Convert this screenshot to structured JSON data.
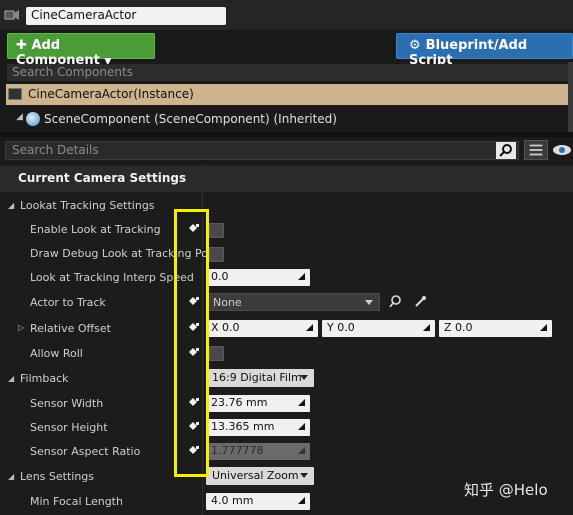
{
  "header": {
    "actor_name": "CineCameraActor"
  },
  "toolbar": {
    "add_component": "Add Component",
    "blueprint": "Blueprint/Add Script"
  },
  "components": {
    "search_placeholder": "Search Components",
    "instance_label": "CineCameraActor(Instance)",
    "scene_label": "SceneComponent (SceneComponent) (Inherited)"
  },
  "details": {
    "search_placeholder": "Search Details",
    "category": "Current Camera Settings",
    "lookat_group": "Lookat Tracking Settings",
    "enable_look": "Enable Look at Tracking",
    "draw_debug": "Draw Debug Look at Tracking Posi",
    "interp_speed": {
      "label": "Look at Tracking Interp Speed",
      "value": "0.0"
    },
    "actor_to_track": {
      "label": "Actor to Track",
      "value": "None"
    },
    "relative_offset": {
      "label": "Relative Offset",
      "x": "X  0.0",
      "y": "Y  0.0",
      "z": "Z  0.0"
    },
    "allow_roll": "Allow Roll",
    "filmback": {
      "label": "Filmback",
      "value": "16:9 Digital Film"
    },
    "sensor_width": {
      "label": "Sensor Width",
      "value": "23.76 mm"
    },
    "sensor_height": {
      "label": "Sensor Height",
      "value": "13.365 mm"
    },
    "sensor_aspect": {
      "label": "Sensor Aspect Ratio",
      "value": "1.777778"
    },
    "lens": {
      "label": "Lens Settings",
      "value": "Universal Zoom"
    },
    "min_focal": {
      "label": "Min Focal Length",
      "value": "4.0 mm"
    }
  },
  "watermark": "知乎 @Helo",
  "colors": {
    "add_button": "#4a9d36",
    "blueprint_button": "#2b6fb0",
    "instance_row": "#cdb48f",
    "highlight_box": "#f3f000"
  }
}
